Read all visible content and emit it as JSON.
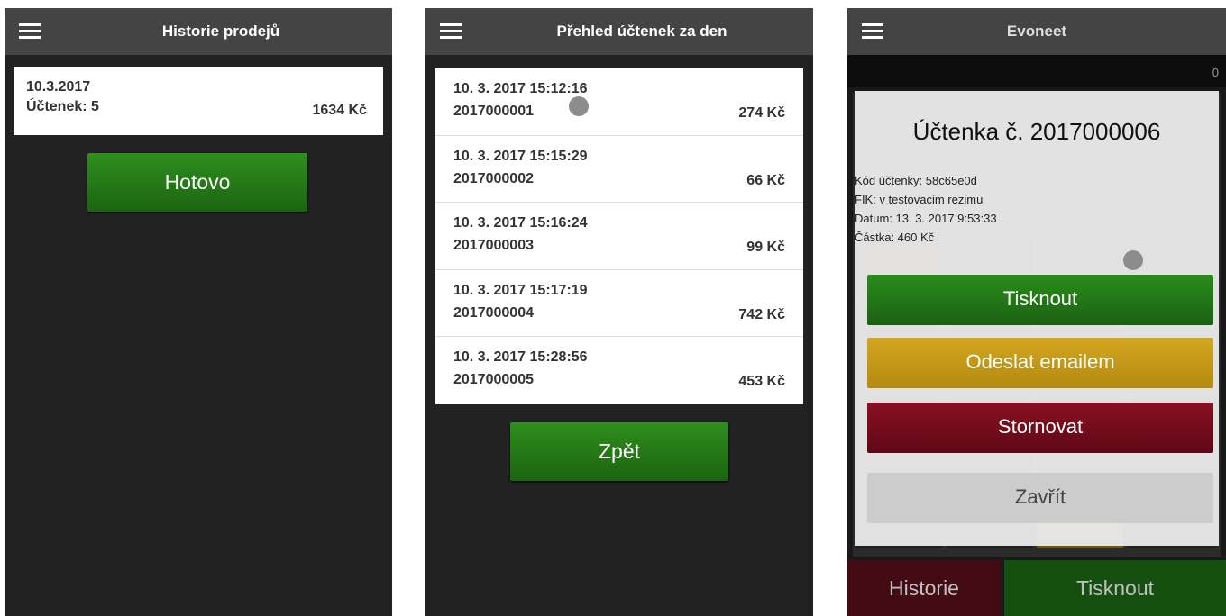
{
  "screen1": {
    "title": "Historie prodejů",
    "card": {
      "date": "10.3.2017",
      "count_label": "Účtenek: 5",
      "amount": "1634 Kč"
    },
    "done_label": "Hotovo"
  },
  "screen2": {
    "title": "Přehled účtenek za den",
    "receipts": [
      {
        "datetime": "10. 3. 2017 15:12:16",
        "number": "2017000001",
        "amount": "274 Kč"
      },
      {
        "datetime": "10. 3. 2017 15:15:29",
        "number": "2017000002",
        "amount": "66 Kč"
      },
      {
        "datetime": "10. 3. 2017 15:16:24",
        "number": "2017000003",
        "amount": "99 Kč"
      },
      {
        "datetime": "10. 3. 2017 15:17:19",
        "number": "2017000004",
        "amount": "742 Kč"
      },
      {
        "datetime": "10. 3. 2017 15:28:56",
        "number": "2017000005",
        "amount": "453 Kč"
      }
    ],
    "back_label": "Zpět"
  },
  "screen3": {
    "title": "Evoneet",
    "counter": "0",
    "modal": {
      "title": "Účtenka č. 2017000006",
      "code": "Kód účtenky: 58c65e0d",
      "fik": "FIK: v testovacim rezimu",
      "date": "Datum: 13. 3. 2017 9:53:33",
      "amount": "Částka: 460 Kč",
      "print_label": "Tisknout",
      "email_label": "Odeslat emailem",
      "storno_label": "Stornovat",
      "close_label": "Zavřít"
    },
    "history_label": "Historie",
    "print_label": "Tisknout"
  },
  "colors": {
    "topbar": "#444444",
    "background": "#222222",
    "green": "#1f6e14",
    "gold": "#c49818",
    "maroon": "#700c1c",
    "grey": "#cccccc"
  }
}
